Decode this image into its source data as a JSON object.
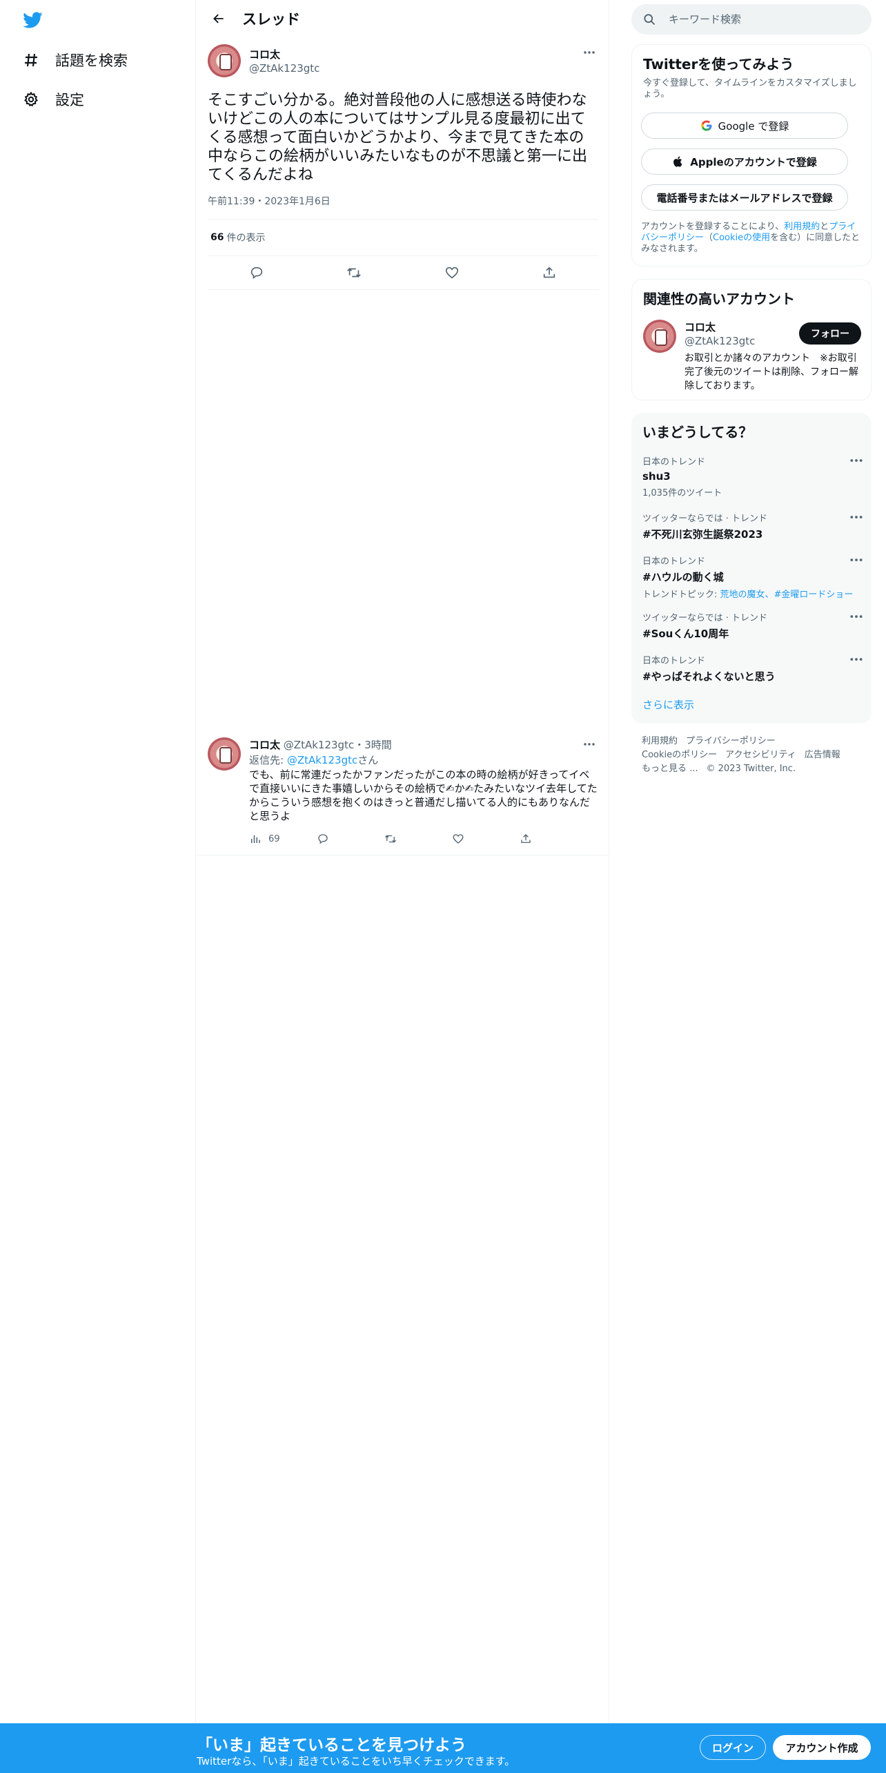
{
  "nav": {
    "items": [
      {
        "label": "話題を検索",
        "icon": "hashtag-icon"
      },
      {
        "label": "設定",
        "icon": "gear-icon"
      }
    ]
  },
  "header": {
    "title": "スレッド"
  },
  "tweet": {
    "name": "コロ太",
    "handle": "@ZtAk123gtc",
    "text": "そこすごい分かる。絶対普段他の人に感想送る時使わないけどこの人の本についてはサンプル見る度最初に出てくる感想って面白いかどうかより、今まで見てきた本の中ならこの絵柄がいいみたいなものが不思議と第一に出てくるんだよね",
    "time": "午前11:39・2023年1月6日",
    "views_count": "66",
    "views_label": "件の表示"
  },
  "reply": {
    "name": "コロ太",
    "handle": "@ZtAk123gtc",
    "time": "・3時間",
    "reply_to_prefix": "返信先: ",
    "reply_to_handle": "@ZtAk123gtc",
    "reply_to_suffix": "さん",
    "text": "でも、前に常連だったかファンだったがこの本の時の絵柄が好きってイベで直接いいにきた事嬉しいからその絵柄で✍か✍たみたいなツイ去年してたからこういう感想を抱くのはきっと普通だし描いてる人的にもありなんだと思うよ",
    "views": "69"
  },
  "search": {
    "placeholder": "キーワード検索"
  },
  "signup": {
    "title": "Twitterを使ってみよう",
    "subtitle": "今すぐ登録して、タイムラインをカスタマイズしましょう。",
    "google": "Google で登録",
    "apple": "Appleのアカウントで登録",
    "phone": "電話番号またはメールアドレスで登録",
    "terms_prefix": "アカウントを登録することにより、",
    "terms_link1": "利用規約",
    "terms_and": "と",
    "terms_link2": "プライバシーポリシー",
    "terms_paren_open": "（",
    "terms_link3": "Cookieの使用",
    "terms_suffix": "を含む）に同意したとみなされます。"
  },
  "related": {
    "title": "関連性の高いアカウント",
    "name": "コロ太",
    "handle": "@ZtAk123gtc",
    "follow": "フォロー",
    "bio": "お取引とか諸々のアカウント　※お取引完了後元のツイートは削除、フォロー解除しております。"
  },
  "trends": {
    "title": "いまどうしてる？",
    "items": [
      {
        "meta": "日本のトレンド",
        "name": "shu3",
        "sub": "1,035件のツイート"
      },
      {
        "meta": "ツイッターならでは · トレンド",
        "name": "#不死川玄弥生誕祭2023",
        "sub": ""
      },
      {
        "meta": "日本のトレンド",
        "name": "#ハウルの動く城",
        "sub_prefix": "トレンドトピック: ",
        "sub_link": "荒地の魔女、#金曜ロードショー"
      },
      {
        "meta": "ツイッターならでは · トレンド",
        "name": "#Souくん10周年",
        "sub": ""
      },
      {
        "meta": "日本のトレンド",
        "name": "#やっぱそれよくないと思う",
        "sub": ""
      }
    ],
    "show_more": "さらに表示"
  },
  "footer": {
    "terms": "利用規約",
    "privacy": "プライバシーポリシー",
    "cookie": "Cookieのポリシー",
    "accessibility": "アクセシビリティ",
    "ads": "広告情報",
    "more": "もっと見る ...",
    "copyright": "© 2023 Twitter, Inc."
  },
  "bottom_bar": {
    "title": "「いま」起きていることを見つけよう",
    "subtitle": "Twitterなら、「いま」起きていることをいち早くチェックできます。",
    "login": "ログイン",
    "signup": "アカウント作成"
  },
  "colors": {
    "accent": "#1d9bf0",
    "text": "#0f1419",
    "muted": "#536471",
    "border": "#eff3f4"
  }
}
